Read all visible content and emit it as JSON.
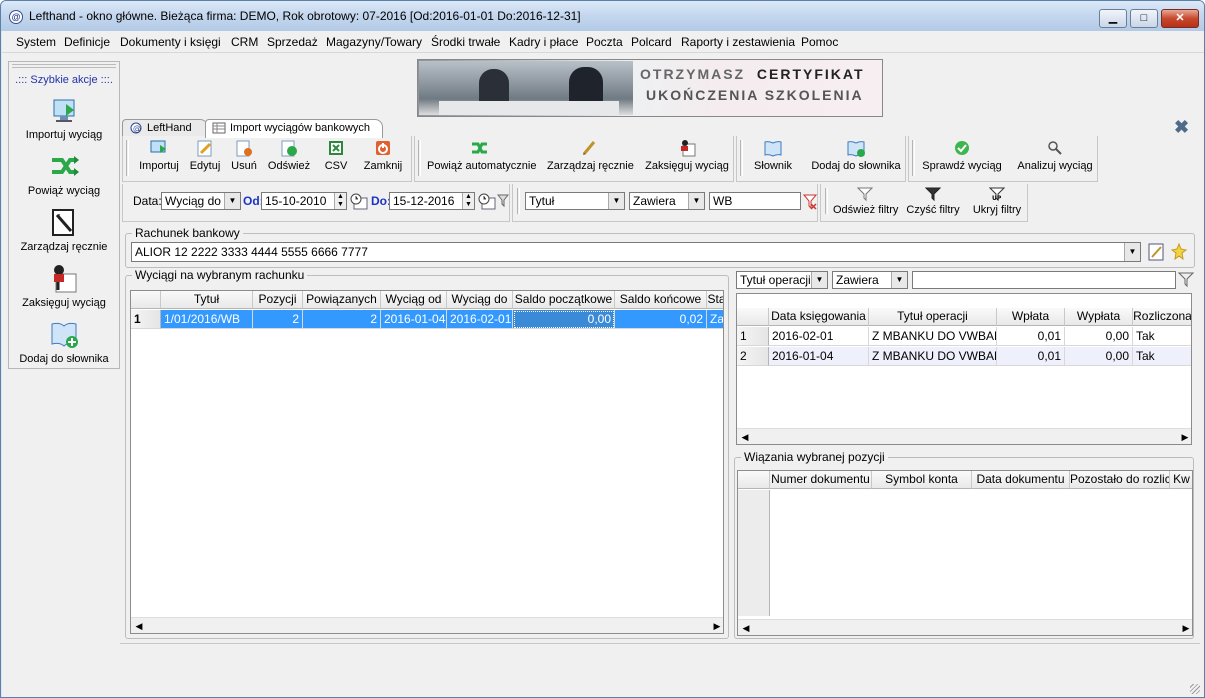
{
  "window": {
    "title": "Lefthand - okno główne. Bieżąca firma: DEMO, Rok obrotowy: 07-2016 [Od:2016-01-01 Do:2016-12-31]",
    "min": "▁",
    "max": "□",
    "close": "✕"
  },
  "menu": [
    "System",
    "Definicje",
    "Dokumenty i księgi",
    "CRM",
    "Sprzedaż",
    "Magazyny/Towary",
    "Środki trwałe",
    "Kadry i płace",
    "Poczta",
    "Polcard",
    "Raporty i zestawienia",
    "Pomoc"
  ],
  "quick": {
    "title": ".::: Szybkie akcje :::.",
    "items": [
      "Importuj wyciąg",
      "Powiąż wyciąg",
      "Zarządzaj ręcznie",
      "Zaksięguj wyciąg",
      "Dodaj do słownika"
    ]
  },
  "banner": {
    "line1a": "OTRZYMASZ",
    "line1b": "CERTYFIKAT",
    "line2": "UKOŃCZENIA SZKOLENIA"
  },
  "tabs": [
    "LeftHand",
    "Import wyciągów bankowych"
  ],
  "toolbar": {
    "g1": [
      "Importuj",
      "Edytuj",
      "Usuń",
      "Odśwież",
      "CSV",
      "Zamknij"
    ],
    "g2": [
      "Powiąż automatycznie",
      "Zarządzaj ręcznie",
      "Zaksięguj wyciąg"
    ],
    "g3": [
      "Słownik",
      "Dodaj do słownika"
    ],
    "g4": [
      "Sprawdź wyciąg",
      "Analizuj wyciąg"
    ]
  },
  "filters": {
    "data_label": "Data:",
    "data_type": "Wyciąg do",
    "od_label": "Od:",
    "od_value": "15-10-2010",
    "do_label": "Do:",
    "do_value": "15-12-2016",
    "field": "Tytuł",
    "op": "Zawiera",
    "value": "WB",
    "buttons": [
      "Odśwież filtry",
      "Czyść filtry",
      "Ukryj filtry"
    ]
  },
  "account": {
    "label": "Rachunek bankowy",
    "value": "ALIOR  12 2222 3333 4444 5555 6666 7777"
  },
  "left_grid": {
    "title": "Wyciągi na wybranym rachunku",
    "headers": [
      "Tytuł",
      "Pozycji",
      "Powiązanych",
      "Wyciąg od",
      "Wyciąg do",
      "Saldo początkowe",
      "Saldo końcowe",
      "Sta"
    ],
    "rows": [
      {
        "n": "1",
        "cells": [
          "1/01/2016/WB",
          "2",
          "2",
          "2016-01-04",
          "2016-02-01",
          "0,00",
          "0,02",
          "Zak"
        ]
      }
    ]
  },
  "right_filter": {
    "field": "Tytuł operacji",
    "op": "Zawiera",
    "value": ""
  },
  "right_grid": {
    "headers": [
      "Data księgowania",
      "Tytuł operacji",
      "Wpłata",
      "Wypłata",
      "Rozliczona"
    ],
    "rows": [
      {
        "n": "1",
        "cells": [
          "2016-02-01",
          "Z MBANKU DO VWBANK",
          "0,01",
          "0,00",
          "Tak"
        ]
      },
      {
        "n": "2",
        "cells": [
          "2016-01-04",
          "Z MBANKU DO VWBANK",
          "0,01",
          "0,00",
          "Tak"
        ]
      }
    ]
  },
  "links": {
    "title": "Wiązania wybranej pozycji",
    "headers": [
      "Numer dokumentu",
      "Symbol konta",
      "Data dokumentu",
      "Pozostało do rozlic.",
      "Kw"
    ]
  }
}
